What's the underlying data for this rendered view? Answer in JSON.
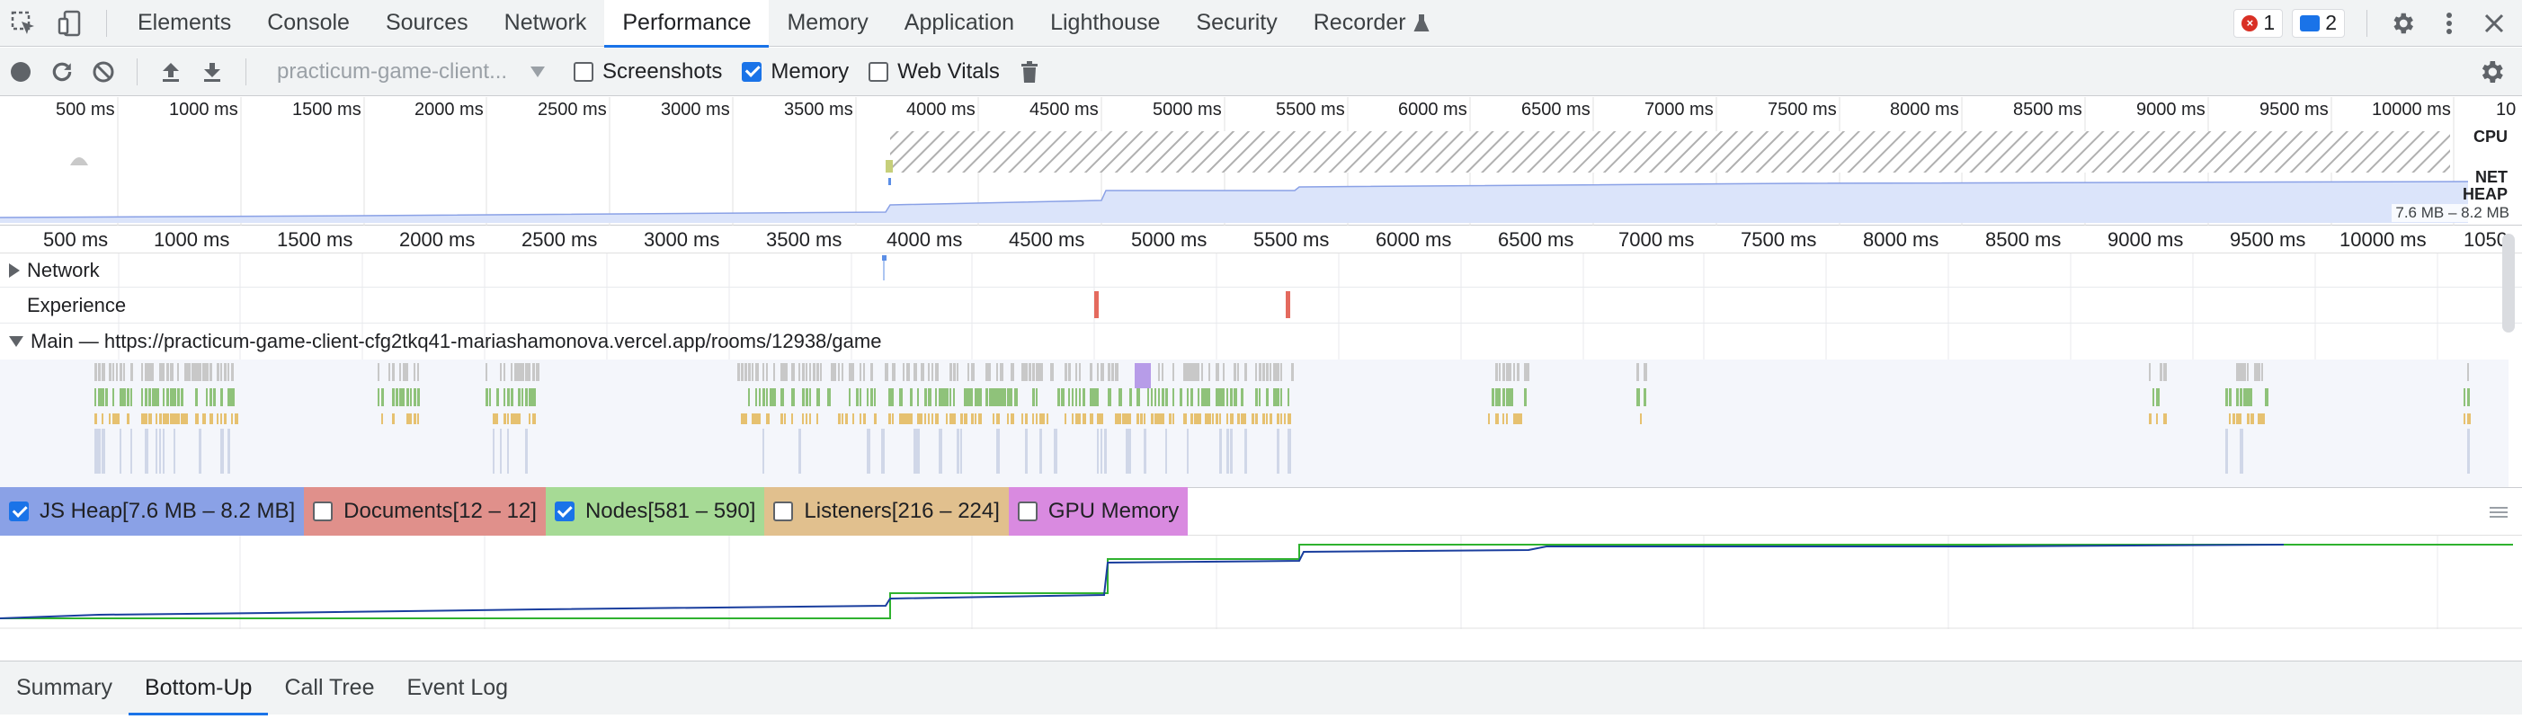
{
  "tabbar": {
    "tabs": [
      "Elements",
      "Console",
      "Sources",
      "Network",
      "Performance",
      "Memory",
      "Application",
      "Lighthouse",
      "Security",
      "Recorder"
    ],
    "active": "Performance",
    "recorder_icon": "flask-icon",
    "error_count": "1",
    "message_count": "2"
  },
  "toolbar": {
    "profile_select": "practicum-game-client...",
    "screenshots_label": "Screenshots",
    "screenshots_checked": false,
    "memory_label": "Memory",
    "memory_checked": true,
    "webvitals_label": "Web Vitals",
    "webvitals_checked": false
  },
  "overview": {
    "ticks": [
      "500 ms",
      "1000 ms",
      "1500 ms",
      "2000 ms",
      "2500 ms",
      "3000 ms",
      "3500 ms",
      "4000 ms",
      "4500 ms",
      "5000 ms",
      "5500 ms",
      "6000 ms",
      "6500 ms",
      "7000 ms",
      "7500 ms",
      "8000 ms",
      "8500 ms",
      "9000 ms",
      "9500 ms",
      "10000 ms",
      "10"
    ],
    "cpu_label": "CPU",
    "net_label": "NET",
    "heap_label": "HEAP",
    "heap_range": "7.6 MB – 8.2 MB"
  },
  "timeline": {
    "ticks": [
      "500 ms",
      "1000 ms",
      "1500 ms",
      "2000 ms",
      "2500 ms",
      "3000 ms",
      "3500 ms",
      "4000 ms",
      "4500 ms",
      "5000 ms",
      "5500 ms",
      "6000 ms",
      "6500 ms",
      "7000 ms",
      "7500 ms",
      "8000 ms",
      "8500 ms",
      "9000 ms",
      "9500 ms",
      "10000 ms",
      "1050"
    ],
    "network_label": "Network",
    "experience_label": "Experience",
    "main_label": "Main — https://practicum-game-client-cfg2tkq41-mariashamonova.vercel.app/rooms/12938/game"
  },
  "counters": [
    {
      "label": "JS Heap[7.6 MB – 8.2 MB]",
      "checked": true,
      "color": "#8aa1e6"
    },
    {
      "label": "Documents[12 – 12]",
      "checked": false,
      "color": "#e0908b"
    },
    {
      "label": "Nodes[581 – 590]",
      "checked": true,
      "color": "#a6da95"
    },
    {
      "label": "Listeners[216 – 224]",
      "checked": false,
      "color": "#e1c08e"
    },
    {
      "label": "GPU Memory",
      "checked": false,
      "color": "#d98ae0"
    }
  ],
  "bottom_tabs": [
    "Summary",
    "Bottom-Up",
    "Call Tree",
    "Event Log"
  ],
  "bottom_active": "Bottom-Up"
}
